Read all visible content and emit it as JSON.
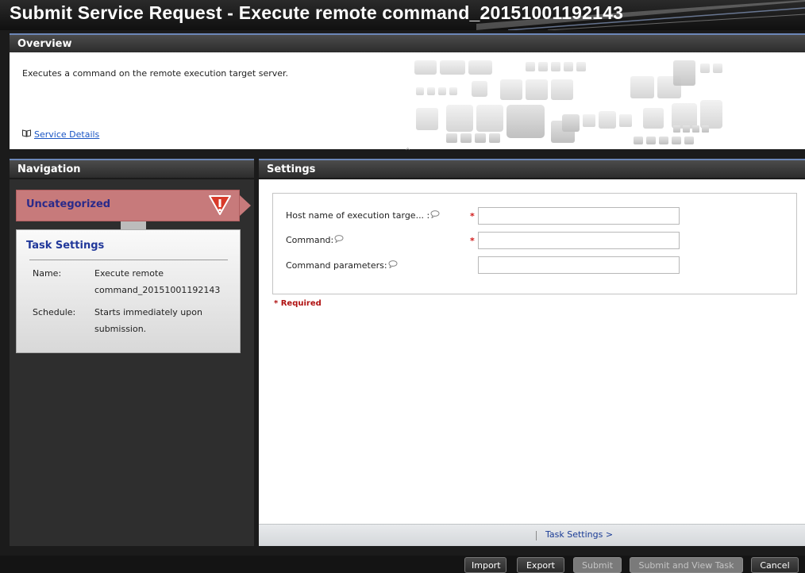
{
  "window": {
    "title": "Submit Service Request - Execute remote command_20151001192143"
  },
  "overview": {
    "heading": "Overview",
    "description": "Executes a command on the remote execution target server.",
    "service_details_link": "Service Details",
    "book_icon": "book-icon",
    "collapse_icon": "chevron-up-icon"
  },
  "navigation": {
    "heading": "Navigation",
    "category_label": "Uncategorized",
    "category_status_icon": "warning-icon",
    "task_settings": {
      "title": "Task Settings",
      "name_label": "Name:",
      "name_value": "Execute remote command_20151001192143",
      "schedule_label": "Schedule:",
      "schedule_value": "Starts immediately upon submission."
    }
  },
  "settings": {
    "heading": "Settings",
    "fields": [
      {
        "label": "Host name of execution targe... :",
        "required": true,
        "value": ""
      },
      {
        "label": "Command:",
        "required": true,
        "value": ""
      },
      {
        "label": "Command parameters:",
        "required": false,
        "value": ""
      }
    ],
    "required_star": "*",
    "required_note": "* Required",
    "footer_link": "Task Settings >",
    "help_icon": "speech-bubble-icon"
  },
  "buttons": {
    "import": "Import",
    "export": "Export",
    "submit": "Submit",
    "submit_and_view": "Submit and View Task",
    "cancel": "Cancel"
  },
  "colors": {
    "category_bg": "#c77a7b",
    "task_title": "#21389a",
    "required_red": "#d01818",
    "link_blue": "#1a55c4"
  }
}
